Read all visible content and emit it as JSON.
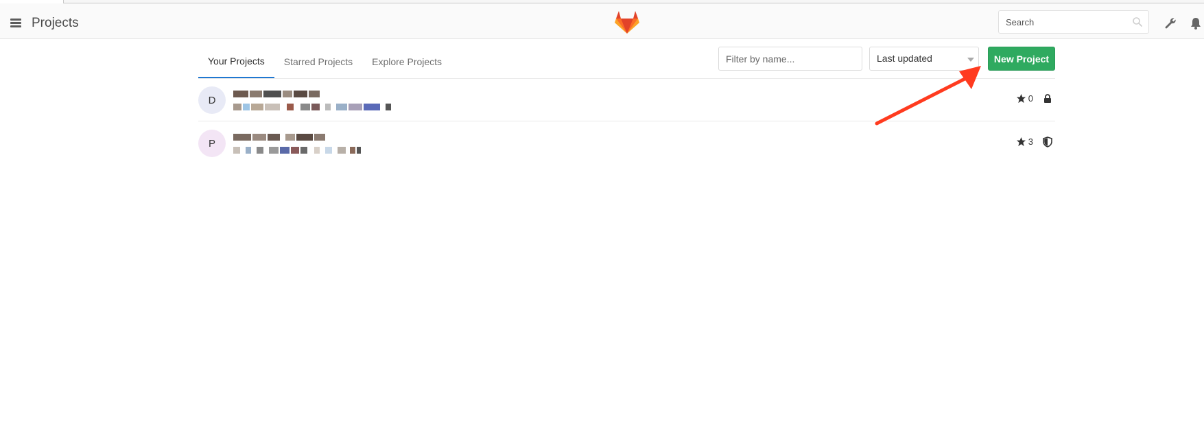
{
  "header": {
    "title": "Projects",
    "search_placeholder": "Search"
  },
  "tabs": [
    {
      "label": "Your Projects",
      "active": true
    },
    {
      "label": "Starred Projects",
      "active": false
    },
    {
      "label": "Explore Projects",
      "active": false
    }
  ],
  "toolbar": {
    "filter_placeholder": "Filter by name...",
    "sort_label": "Last updated",
    "new_project_label": "New Project"
  },
  "projects": [
    {
      "initial": "D",
      "stars": "0",
      "visibility": "private",
      "visibility_icon": "lock-icon"
    },
    {
      "initial": "P",
      "stars": "3",
      "visibility": "internal",
      "visibility_icon": "shield-icon"
    }
  ],
  "colors": {
    "accent_green": "#2faa60",
    "tab_underline": "#1f78d1",
    "annotation_arrow": "#ff3b1f"
  }
}
